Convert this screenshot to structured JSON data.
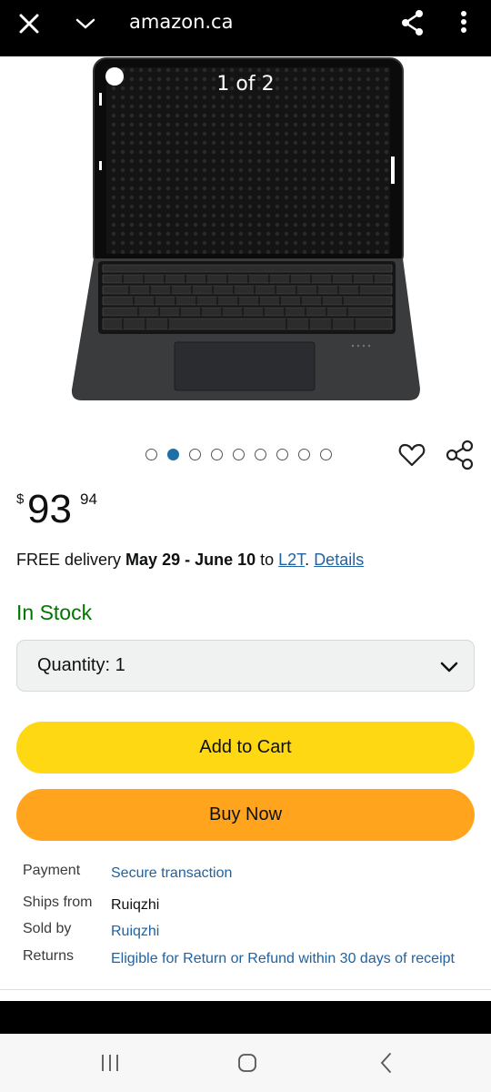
{
  "browser": {
    "url": "amazon.ca",
    "icons": {
      "close": "close-icon",
      "tabs": "chevron-down-icon",
      "share": "share-icon",
      "menu": "more-vert-icon"
    }
  },
  "gallery": {
    "counter": "1 of 2",
    "dot_count": 9,
    "active_index": 1,
    "image_subject": "tablet keyboard case"
  },
  "product": {
    "price_currency": "$",
    "price_whole": "93",
    "price_fraction": "94",
    "delivery_prefix": "FREE delivery ",
    "delivery_dates": "May 29 - June 10",
    "delivery_to": " to ",
    "delivery_postal": "L2T",
    "delivery_sep": ". ",
    "delivery_details": "Details",
    "availability": "In Stock",
    "quantity_label": "Quantity: 1"
  },
  "buttons": {
    "add_to_cart": "Add to Cart",
    "buy_now": "Buy Now"
  },
  "details": [
    {
      "key": "Payment",
      "value": "Secure transaction"
    },
    {
      "key": "Ships from",
      "value": "Ruiqzhi"
    },
    {
      "key": "Sold by",
      "value": "Ruiqzhi"
    },
    {
      "key": "Returns",
      "value": "Eligible for Return or Refund within 30 days of receipt"
    }
  ],
  "colors": {
    "add_to_cart": "#ffd814",
    "buy_now": "#ffa41c",
    "in_stock": "#007600",
    "link": "#2162a1",
    "dot_active": "#1e6fa8"
  }
}
